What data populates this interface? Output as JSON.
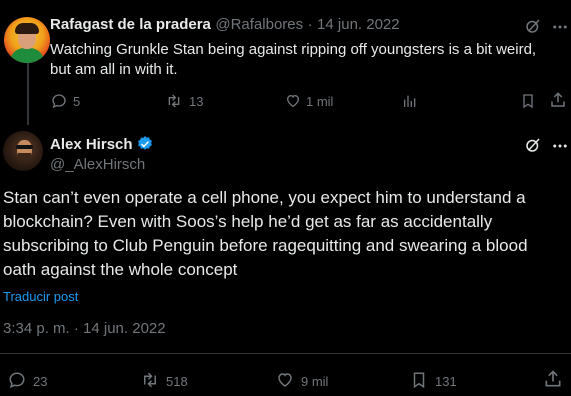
{
  "reply_tweet": {
    "author_name": "Rafagast de la pradera",
    "author_handle": "@Rafalbores",
    "separator": "·",
    "date": "14 jun. 2022",
    "text_line1": "Watching Grunkle Stan being against ripping off youngsters is a bit weird,",
    "text_line2": "but am all in with it.",
    "replies": "5",
    "retweets": "13",
    "likes": "1 mil"
  },
  "main_tweet": {
    "author_name": "Alex Hirsch",
    "author_handle": "@_AlexHirsch",
    "verified": true,
    "text_lines": [
      "Stan can’t even operate a cell phone, you expect him to understand a",
      "blockchain? Even with Soos’s help he’d get as far as accidentally",
      "subscribing to Club Penguin before ragequitting and swearing a blood",
      "oath against the whole concept"
    ],
    "translate_label": "Traducir post",
    "timestamp": "3:34 p. m. · 14 jun. 2022",
    "replies": "23",
    "retweets": "518",
    "likes": "9 mil",
    "bookmarks": "131"
  },
  "colors": {
    "background": "#000000",
    "text": "#e7e9ea",
    "muted": "#71767b",
    "accent": "#1d9bf0",
    "divider": "#2f3336"
  },
  "icons": [
    "reply-icon",
    "retweet-icon",
    "like-icon",
    "views-icon",
    "bookmark-icon",
    "share-icon",
    "grok-icon",
    "verified-badge-icon"
  ]
}
